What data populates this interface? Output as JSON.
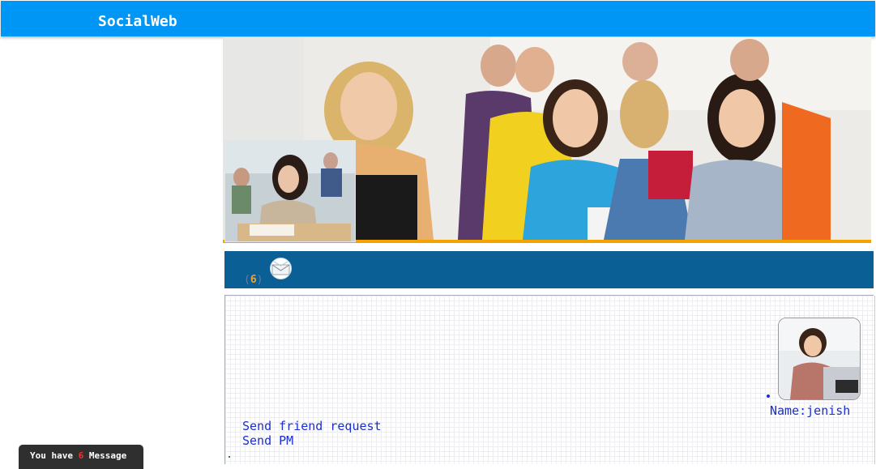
{
  "header": {
    "brand": "SocialWeb"
  },
  "banner": {
    "image": "students-group-photo",
    "thumbnail": "student-writing-exam-photo"
  },
  "messages": {
    "count": "6",
    "open_paren": "(",
    "close_paren": ")",
    "icon": "envelope-icon"
  },
  "profile": {
    "avatar": "woman-at-desk-photo",
    "name_label": "Name:jenish",
    "actions": [
      "Send friend request",
      "Send PM"
    ]
  },
  "toast": {
    "prefix": "You have",
    "count": "6",
    "suffix": "Message"
  },
  "colors": {
    "header": "#0096f5",
    "msgbar": "#0a5f95",
    "accent": "#f4a200",
    "link": "#1a2fd0"
  }
}
